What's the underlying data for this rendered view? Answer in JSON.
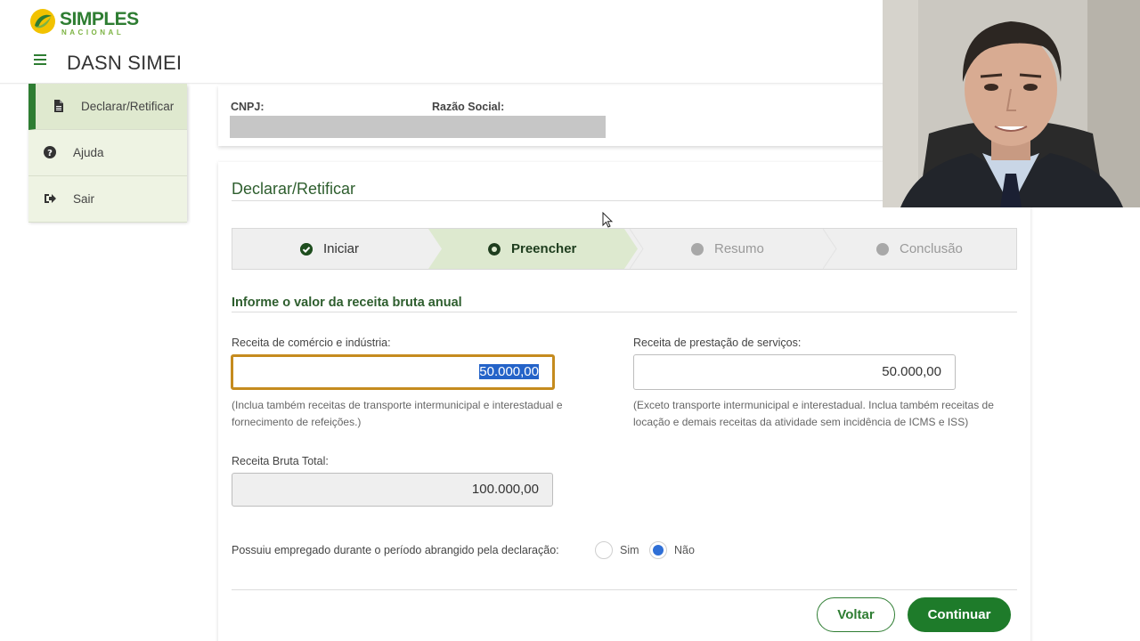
{
  "header": {
    "logo_main": "SIMPLES",
    "logo_sub": "NACIONAL",
    "app_title": "DASN SIMEI"
  },
  "sidebar": {
    "items": [
      {
        "label": "Declarar/Retificar",
        "icon": "document-icon",
        "active": true
      },
      {
        "label": "Ajuda",
        "icon": "question-icon",
        "active": false
      },
      {
        "label": "Sair",
        "icon": "sign-out-icon",
        "active": false
      }
    ]
  },
  "info": {
    "cnpj_label": "CNPJ:",
    "razao_label": "Razão Social:"
  },
  "main": {
    "title": "Declarar/Retificar",
    "steps": [
      {
        "label": "Iniciar",
        "state": "done"
      },
      {
        "label": "Preencher",
        "state": "current"
      },
      {
        "label": "Resumo",
        "state": "pending"
      },
      {
        "label": "Conclusão",
        "state": "pending"
      }
    ],
    "section_title": "Informe o valor da receita bruta anual",
    "comercio": {
      "label": "Receita de comércio e indústria:",
      "value": "50.000,00",
      "help": "(Inclua também receitas de transporte intermunicipal e interestadual e fornecimento de refeições.)"
    },
    "servicos": {
      "label": "Receita de prestação de serviços:",
      "value": "50.000,00",
      "help": "(Exceto transporte intermunicipal e interestadual. Inclua também receitas de locação e demais receitas da atividade sem incidência de ICMS e ISS)"
    },
    "total": {
      "label": "Receita Bruta Total:",
      "value": "100.000,00"
    },
    "empregado": {
      "question": "Possuiu empregado durante o período abrangido pela declaração:",
      "options": [
        "Sim",
        "Não"
      ],
      "selected": "Não"
    },
    "buttons": {
      "back": "Voltar",
      "next": "Continuar"
    }
  },
  "colors": {
    "brand_green": "#2e7d32",
    "primary_button": "#1e7b2a",
    "focus_border": "#c58b1e",
    "selection": "#2463c8",
    "radio_checked": "#2f6fd6"
  }
}
